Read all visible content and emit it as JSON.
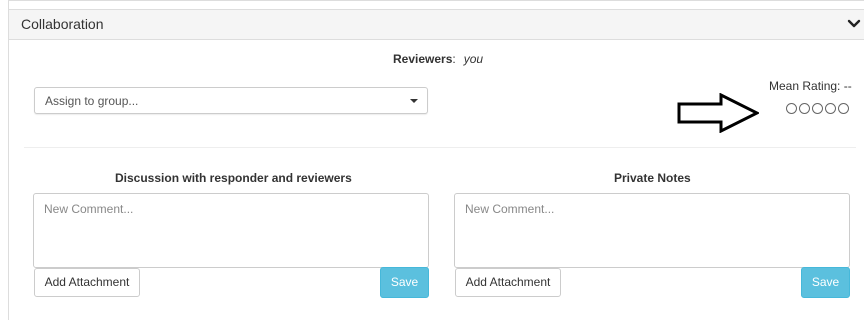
{
  "panel": {
    "title": "Collaboration",
    "toggle_icon": "chevron-down-icon"
  },
  "reviewers": {
    "label": "Reviewers",
    "separator": ":",
    "value": "you"
  },
  "group_select": {
    "placeholder": "Assign to group...",
    "caret_icon": "caret-down-icon"
  },
  "rating": {
    "label": "Mean Rating: --",
    "max": 5,
    "value": 0,
    "annotation_icon": "right-arrow-icon"
  },
  "discussion": {
    "title": "Discussion with responder and reviewers",
    "placeholder": "New Comment...",
    "attach_label": "Add Attachment",
    "save_label": "Save"
  },
  "private_notes": {
    "title": "Private Notes",
    "placeholder": "New Comment...",
    "attach_label": "Add Attachment",
    "save_label": "Save"
  },
  "colors": {
    "header_bg": "#f5f5f5",
    "border": "#dddddd",
    "save_button": "#5bc0de"
  }
}
